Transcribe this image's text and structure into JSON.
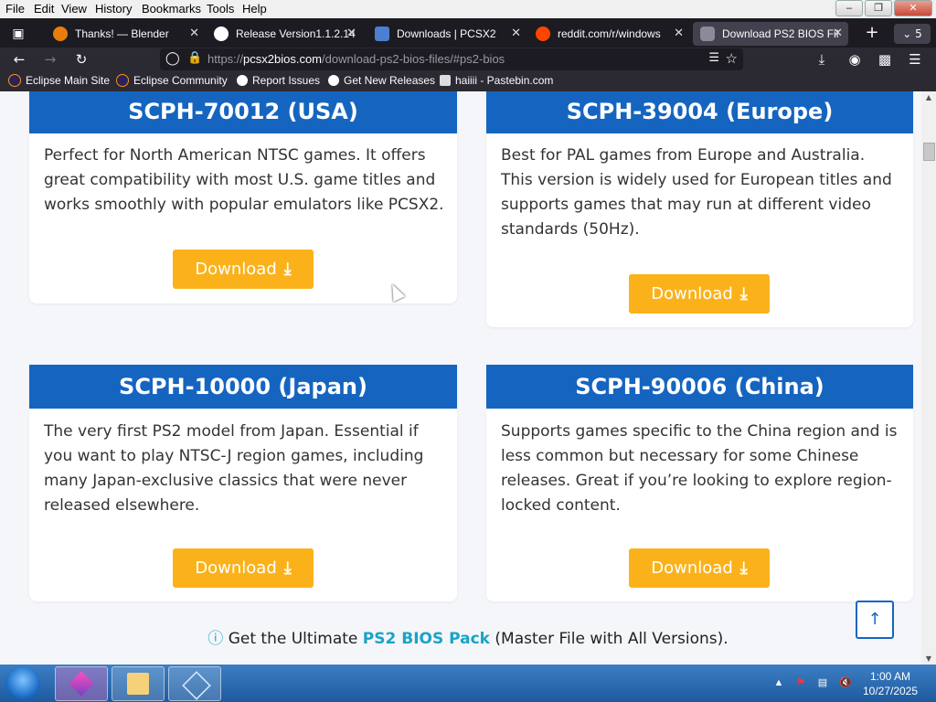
{
  "menu": [
    "File",
    "Edit",
    "View",
    "History",
    "Bookmarks",
    "Tools",
    "Help"
  ],
  "tabs": [
    {
      "title": "Thanks! — Blender",
      "icon": "blender-icon"
    },
    {
      "title": "Release Version1.1.2.14",
      "icon": "github-icon"
    },
    {
      "title": "Downloads | PCSX2",
      "icon": "pcsx2-icon"
    },
    {
      "title": "reddit.com/r/windows",
      "icon": "reddit-icon"
    },
    {
      "title": "Download PS2 BIOS Fil",
      "icon": "gamepad-icon"
    }
  ],
  "tab_count": "5",
  "url": {
    "prefix": "https://",
    "host": "pcsx2bios.com",
    "path": "/download-ps2-bios-files/#ps2-bios"
  },
  "bookmarks": [
    "Eclipse Main Site",
    "Eclipse Community",
    "Report Issues",
    "Get New Releases",
    "haiiii - Pastebin.com"
  ],
  "cards": [
    {
      "title": "SCPH-70012 (USA)",
      "desc": "Perfect for North American NTSC games. It offers great compatibility with most U.S. game titles and works smoothly with popular emulators like PCSX2.",
      "button": "Download"
    },
    {
      "title": "SCPH-39004 (Europe)",
      "desc": "Best for PAL games from Europe and Australia. This version is widely used for European titles and supports games that may run at different video standards (50Hz).",
      "button": "Download"
    },
    {
      "title": "SCPH-10000 (Japan)",
      "desc": "The very first PS2 model from Japan. Essential if you want to play NTSC-J region games, including many Japan-exclusive classics that were never released elsewhere.",
      "button": "Download"
    },
    {
      "title": "SCPH-90006 (China)",
      "desc": "Supports games specific to the China region and is less common but necessary for some Chinese releases. Great if you’re looking to explore region-locked content.",
      "button": "Download"
    }
  ],
  "pack": {
    "prefix": "Get the Ultimate ",
    "link": "PS2 BIOS Pack",
    "suffix": " (Master File with All Versions)."
  },
  "clock": {
    "time": "1:00 AM",
    "date": "10/27/2025"
  },
  "colors": {
    "header_blue": "#1565c0",
    "button_orange": "#fbb21a",
    "link_teal": "#1aa3c8"
  }
}
